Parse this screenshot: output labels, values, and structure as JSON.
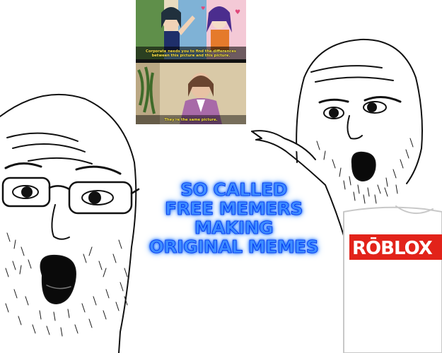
{
  "inner_meme": {
    "caption_top": "Corporate needs you to find the differences between this picture and this picture.",
    "caption_bottom": "They're the same picture."
  },
  "headline": "SO CALLED\nFREE MEMERS\nMAKING\nORIGINAL MEMES",
  "shirt_logo": "RŌBLOX"
}
